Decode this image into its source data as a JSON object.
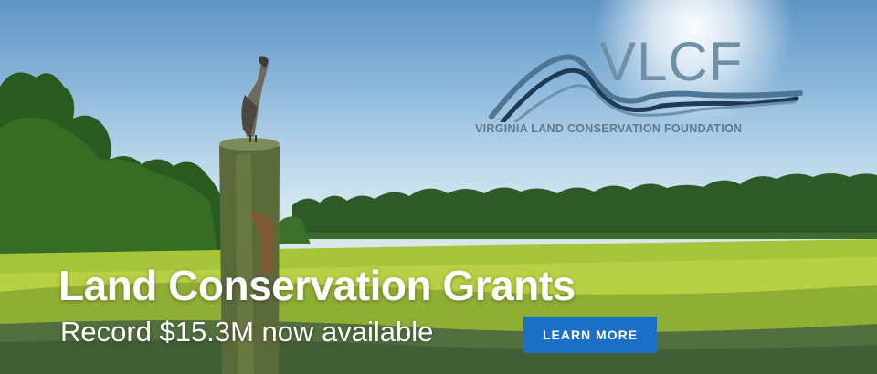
{
  "logo": {
    "letters": "VLCF",
    "full_name": "VIRGINIA LAND CONSERVATION FOUNDATION",
    "primary_color": "#7090a8",
    "wave_dark": "#1e3a55",
    "wave_mid": "#4f7594"
  },
  "hero": {
    "headline": "Land Conservation Grants",
    "subline": "Record $15.3M now available",
    "cta_label": "LEARN MORE",
    "cta_color": "#1c6fc6"
  },
  "icons": [
    "heron-on-post-image",
    "vlcf-mountain-wave-logo"
  ]
}
